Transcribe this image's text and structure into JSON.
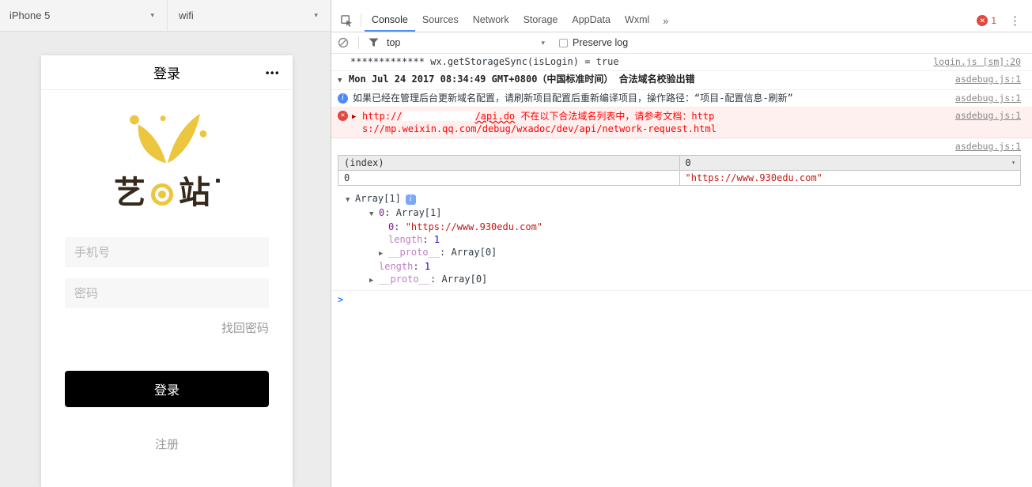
{
  "icons": {
    "caret_down": "▾",
    "triangle_down": "▼",
    "triangle_right": "▶",
    "menu_dots": "•••",
    "kebab": "⋮",
    "more_chevron": "»",
    "prompt_chevron": ">",
    "info_glyph": "i",
    "close_glyph": "✕"
  },
  "simulator": {
    "device": "iPhone 5",
    "network": "wifi",
    "app": {
      "header_title": "登录",
      "logo_left": "艺",
      "logo_right": "站",
      "phone_input_placeholder": "手机号",
      "password_input_placeholder": "密码",
      "forgot_password_link": "找回密码",
      "login_button_label": "登录",
      "register_link": "注册"
    }
  },
  "devtools": {
    "tabs": [
      {
        "label": "Console"
      },
      {
        "label": "Sources"
      },
      {
        "label": "Network"
      },
      {
        "label": "Storage"
      },
      {
        "label": "AppData"
      },
      {
        "label": "Wxml"
      }
    ],
    "error_badge_count": "1",
    "toolbar": {
      "context_selector": "top",
      "preserve_log_label": "Preserve log"
    },
    "console": {
      "log1": {
        "text": "************* wx.getStorageSync(isLogin) = true",
        "source": "login.js [sm]:20"
      },
      "group_header": {
        "text": "Mon Jul 24 2017 08:34:49 GMT+0800（中国标准时间） 合法域名校验出错",
        "source": "asdebug.js:1"
      },
      "info_msg": {
        "text": "如果已经在管理后台更新域名配置，请刷新项目配置后重新编译项目，操作路径：“项目-配置信息-刷新”",
        "source": "asdebug.js:1"
      },
      "error_msg": {
        "url_prefix": "http://",
        "url_path": "/api.do",
        "text_part1": " 不在以下合法域名列表中，请参考文档：",
        "doc_url": "https://mp.weixin.qq.com/debug/wxadoc/dev/api/network-request.html",
        "source": "asdebug.js:1"
      },
      "table_source": "asdebug.js:1",
      "table": {
        "headers": [
          "(index)",
          "0"
        ],
        "row": [
          "0",
          "\"https://www.930edu.com\""
        ]
      },
      "tree": {
        "root_label": "Array[1]",
        "child0_key": "0",
        "child0_value": "Array[1]",
        "item0_key": "0",
        "item0_value": "\"https://www.930edu.com\"",
        "len_inner_key": "length",
        "len_inner_value": "1",
        "proto_inner_key": "__proto__",
        "proto_inner_value": "Array[0]",
        "len_outer_key": "length",
        "len_outer_value": "1",
        "proto_outer_key": "__proto__",
        "proto_outer_value": "Array[0]"
      }
    }
  }
}
